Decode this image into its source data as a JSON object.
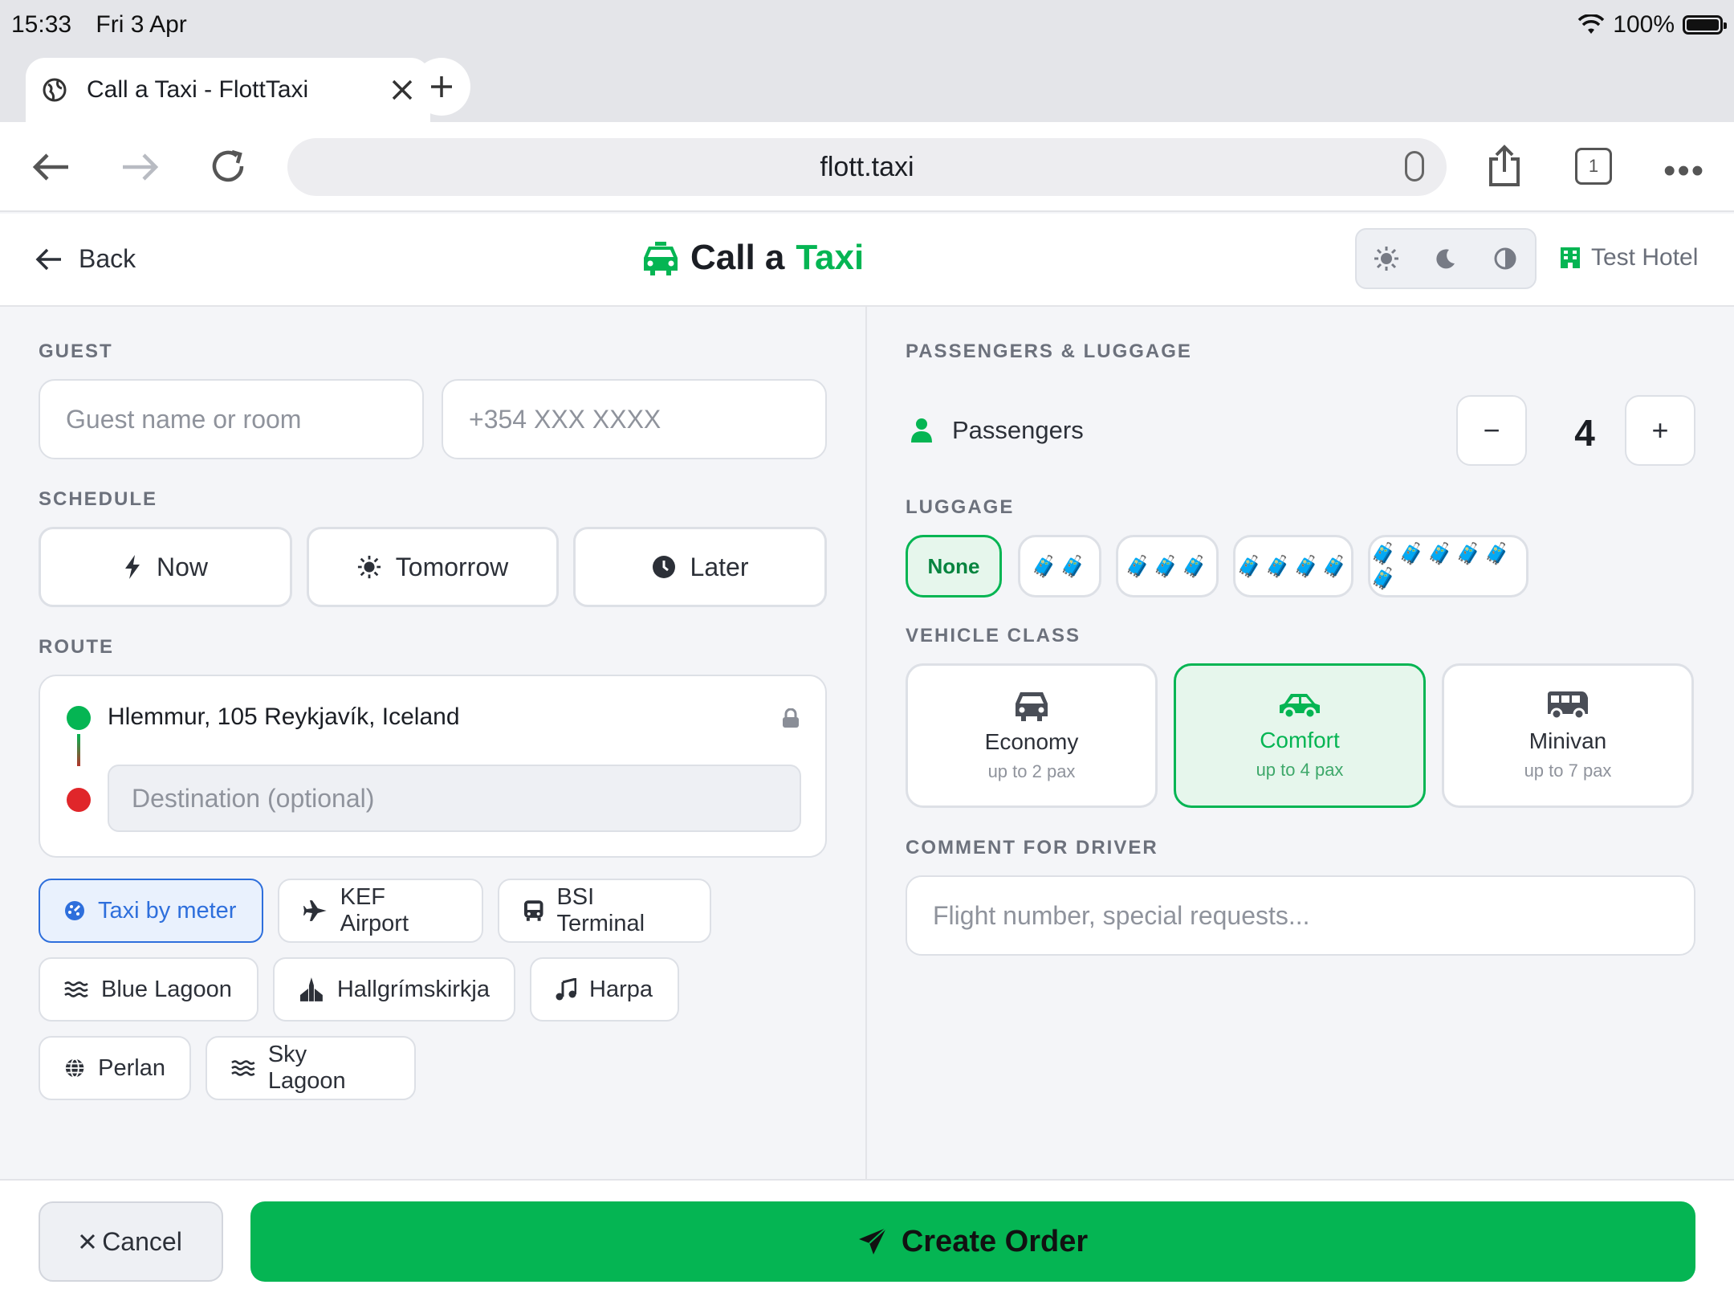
{
  "status_bar": {
    "time": "15:33",
    "date": "Fri 3 Apr",
    "battery": "100%"
  },
  "browser": {
    "tab_title": "Call a Taxi - FlottTaxi",
    "url": "flott.taxi",
    "tab_count": "1"
  },
  "header": {
    "back_label": "Back",
    "title_part1": "Call a",
    "title_part2": "Taxi",
    "hotel": "Test Hotel"
  },
  "guest": {
    "section_label": "GUEST",
    "name_placeholder": "Guest name or room",
    "phone_placeholder": "+354 XXX XXXX"
  },
  "schedule": {
    "section_label": "SCHEDULE",
    "options": [
      "Now",
      "Tomorrow",
      "Later"
    ]
  },
  "route": {
    "section_label": "ROUTE",
    "origin": "Hlemmur, 105 Reykjavík, Iceland",
    "destination_placeholder": "Destination (optional)"
  },
  "presets": [
    {
      "label": "Taxi by meter",
      "icon": "meter-icon",
      "active": true
    },
    {
      "label": "KEF Airport",
      "icon": "plane-icon",
      "active": false
    },
    {
      "label": "BSI Terminal",
      "icon": "bus-icon",
      "active": false
    },
    {
      "label": "Blue Lagoon",
      "icon": "water-icon",
      "active": false
    },
    {
      "label": "Hallgrímskirkja",
      "icon": "church-icon",
      "active": false
    },
    {
      "label": "Harpa",
      "icon": "music-icon",
      "active": false
    },
    {
      "label": "Perlan",
      "icon": "globe-icon",
      "active": false
    },
    {
      "label": "Sky Lagoon",
      "icon": "water-icon",
      "active": false
    }
  ],
  "passengers": {
    "section_label": "PASSENGERS & LUGGAGE",
    "label": "Passengers",
    "count": "4",
    "minus": "−",
    "plus": "+"
  },
  "luggage": {
    "section_label": "LUGGAGE",
    "options": [
      "None",
      "🧳🧳",
      "🧳🧳🧳",
      "🧳🧳🧳🧳",
      "🧳🧳🧳🧳🧳🧳"
    ],
    "selected": "None"
  },
  "vehicle": {
    "section_label": "VEHICLE CLASS",
    "options": [
      {
        "name": "Economy",
        "capacity": "up to 2 pax"
      },
      {
        "name": "Comfort",
        "capacity": "up to 4 pax"
      },
      {
        "name": "Minivan",
        "capacity": "up to 7 pax"
      }
    ],
    "selected": "Comfort"
  },
  "comment": {
    "section_label": "COMMENT FOR DRIVER",
    "placeholder": "Flight number, special requests..."
  },
  "footer": {
    "cancel_label": "Cancel",
    "create_label": "Create Order"
  },
  "colors": {
    "accent_green": "#05b553",
    "active_blue": "#2e6fdc",
    "destination_red": "#e0262a"
  }
}
